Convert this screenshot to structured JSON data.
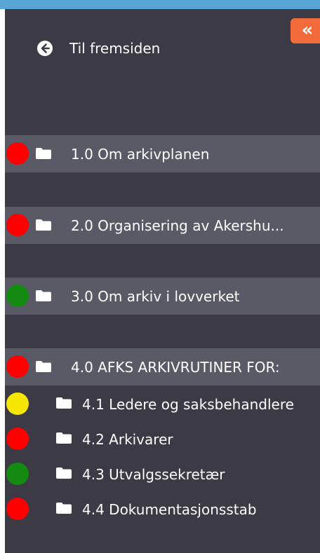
{
  "header": {
    "collapse_label": "«",
    "back_label": "Til fremsiden"
  },
  "colors": {
    "topbar": "#58a6d6",
    "panel": "#3b3a45",
    "highlight": "#5a5966",
    "collapse": "#f26b3a",
    "red": "#ff0000",
    "green": "#138a10",
    "yellow": "#f7e600"
  },
  "items": [
    {
      "label": "1.0 Om arkivplanen",
      "status": "red"
    },
    {
      "label": "2.0 Organisering av Akershu...",
      "status": "red"
    },
    {
      "label": "3.0 Om arkiv i lovverket",
      "status": "green"
    },
    {
      "label": "4.0 AFKS ARKIVRUTINER FOR:",
      "status": "red"
    },
    {
      "label": "4.1 Ledere og saksbehandlere",
      "status": "yellow"
    },
    {
      "label": "4.2 Arkivarer",
      "status": "red"
    },
    {
      "label": "4.3 Utvalgssekretær",
      "status": "green"
    },
    {
      "label": "4.4 Dokumentasjonsstab",
      "status": "red"
    }
  ]
}
